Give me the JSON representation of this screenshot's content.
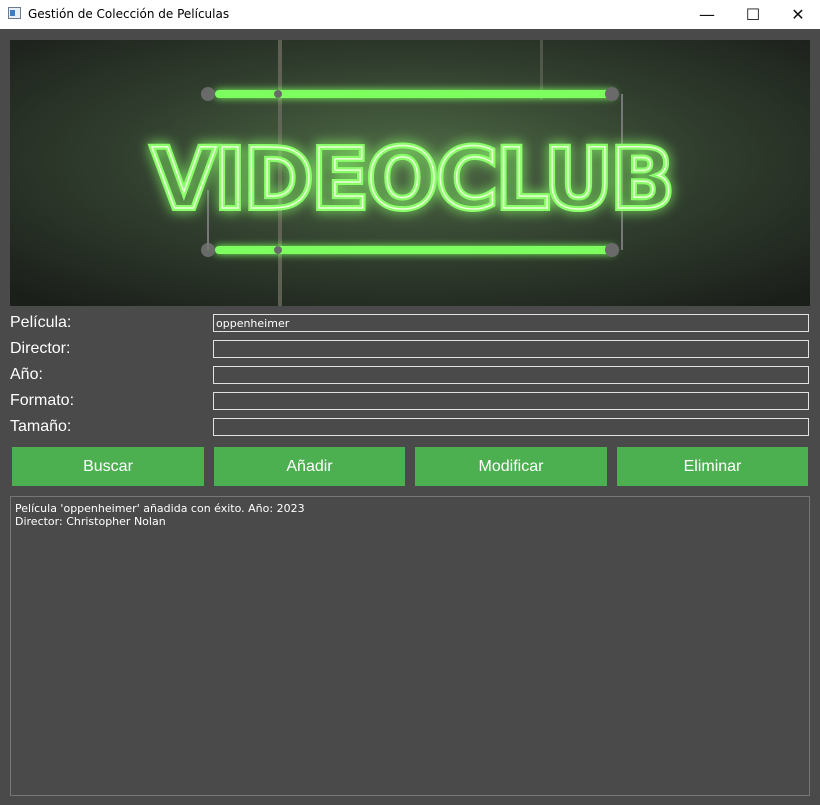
{
  "window": {
    "title": "Gestión de Colección de Películas",
    "minimize_glyph": "—",
    "maximize_glyph": "☐",
    "close_glyph": "✕"
  },
  "banner": {
    "sign_text": "VIDEOCLUB",
    "neon_color": "#39ff3a"
  },
  "form": {
    "fields": [
      {
        "label": "Película:",
        "value": "oppenheimer"
      },
      {
        "label": "Director:",
        "value": ""
      },
      {
        "label": "Año:",
        "value": ""
      },
      {
        "label": "Formato:",
        "value": ""
      },
      {
        "label": "Tamaño:",
        "value": ""
      }
    ]
  },
  "buttons": {
    "search": "Buscar",
    "add": "Añadir",
    "modify": "Modificar",
    "delete": "Eliminar"
  },
  "output": {
    "text": "Película 'oppenheimer' añadida con éxito. Año: 2023\n Director: Christopher Nolan"
  },
  "colors": {
    "background": "#4a4a4a",
    "button": "#4caf50"
  }
}
